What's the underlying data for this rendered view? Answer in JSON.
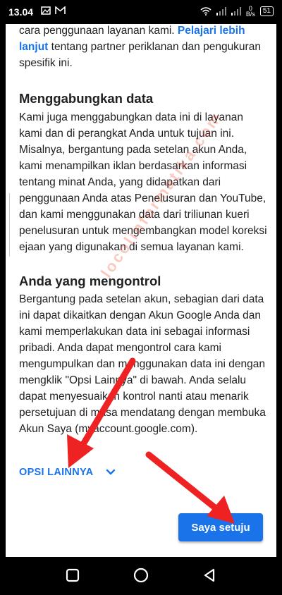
{
  "status_bar": {
    "time": "13.04",
    "net_speed_value": "0",
    "net_speed_unit": "B/s",
    "battery": "51"
  },
  "sections": {
    "intro_text_1": "cara penggunaan layanan kami. ",
    "intro_link": "Pelajari lebih lanjut",
    "intro_text_2": " tentang partner periklanan dan pengukuran spesifik ini.",
    "combine_heading": "Menggabungkan data",
    "combine_body": "Kami juga menggabungkan data ini di layanan kami dan di perangkat Anda untuk tujuan ini. Misalnya, bergantung pada setelan akun Anda, kami menampilkan iklan berdasarkan informasi tentang minat Anda, yang didapatkan dari penggunaan Anda atas Penelusuran dan YouTube, dan kami menggunakan data dari triliunan kueri penelusuran untuk mengembangkan model koreksi ejaan yang digunakan di semua layanan kami.",
    "control_heading": "Anda yang mengontrol",
    "control_body": "Bergantung pada setelan akun, sebagian dari data ini dapat dikaitkan dengan Akun Google Anda dan kami memperlakukan data ini sebagai informasi pribadi. Anda dapat mengontrol cara kami mengumpulkan dan menggunakan data ini dengan mengklik \"Opsi Lainnya\" di bawah. Anda selalu dapat menyesuaikan kontrol nanti atau menarik persetujuan di masa mendatang dengan membuka Akun Saya (myaccount.google.com)."
  },
  "actions": {
    "more_options_label": "OPSI LAINNYA",
    "agree_label": "Saya setuju"
  },
  "watermark": "locolinformatika.com",
  "colors": {
    "accent": "#1a73e8",
    "arrow": "#ee2222"
  },
  "icons": {
    "chevron": "chevron-down-icon",
    "nav_recent": "square-icon",
    "nav_home": "circle-icon",
    "nav_back": "triangle-back-icon"
  }
}
